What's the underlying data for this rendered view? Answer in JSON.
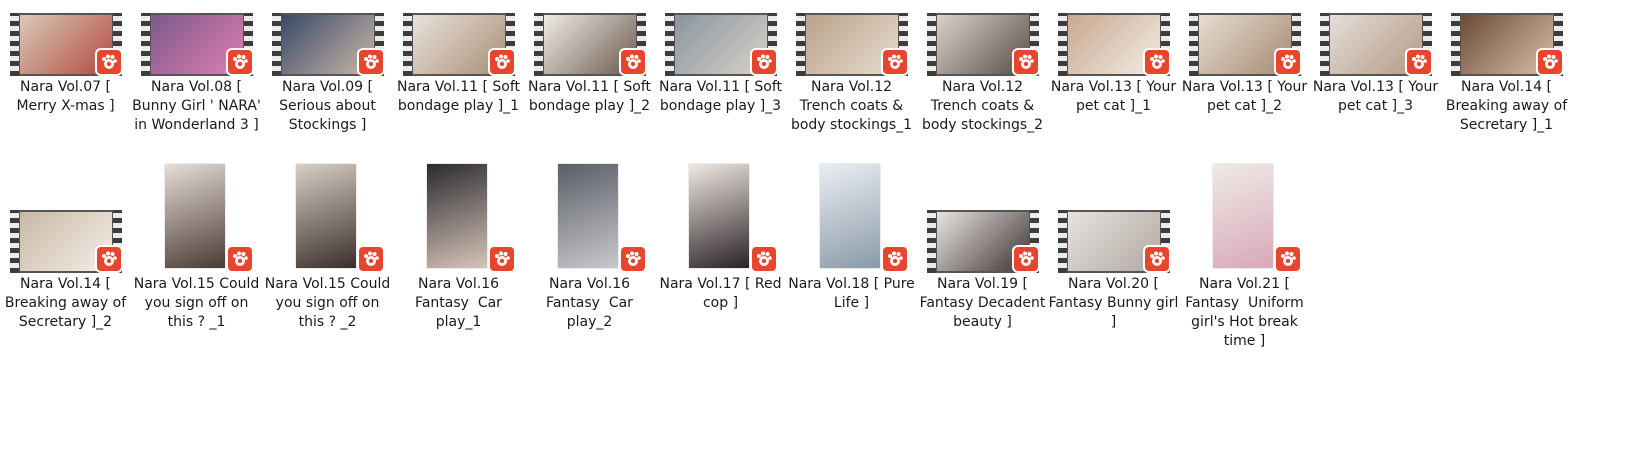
{
  "files": [
    {
      "name": "Nara Vol.07 [ Merry X-mas ]",
      "kind": "video",
      "icon": "video-file-icon",
      "colors": [
        "#d9c9b8",
        "#b24a3f"
      ]
    },
    {
      "name": "Nara Vol.08 [ Bunny Girl ' NARA' in Wonderland 3 ]",
      "kind": "video",
      "icon": "video-file-icon",
      "colors": [
        "#7a5a8a",
        "#e07fb0"
      ]
    },
    {
      "name": "Nara Vol.09 [ Serious about Stockings ]",
      "kind": "video",
      "icon": "video-file-icon",
      "colors": [
        "#3a4a6a",
        "#c9b7a8"
      ]
    },
    {
      "name": "Nara Vol.11 [ Soft bondage play ]_1",
      "kind": "video",
      "icon": "video-file-icon",
      "colors": [
        "#e8e2da",
        "#a88e78"
      ]
    },
    {
      "name": "Nara Vol.11 [ Soft bondage play ]_2",
      "kind": "video",
      "icon": "video-file-icon",
      "colors": [
        "#f0ece6",
        "#6a5a4e"
      ]
    },
    {
      "name": "Nara Vol.11 [ Soft bondage play ]_3",
      "kind": "video",
      "icon": "video-file-icon",
      "colors": [
        "#8a949e",
        "#d8d2ca"
      ]
    },
    {
      "name": "Nara Vol.12 Trench coats & body stockings_1",
      "kind": "video",
      "icon": "video-file-icon",
      "colors": [
        "#b8a28a",
        "#e8dccf"
      ]
    },
    {
      "name": "Nara Vol.12 Trench coats & body stockings_2",
      "kind": "video",
      "icon": "video-file-icon",
      "colors": [
        "#d8d2cc",
        "#5a4e46"
      ]
    },
    {
      "name": "Nara Vol.13 [ Your pet cat ]_1",
      "kind": "video",
      "icon": "video-file-icon",
      "colors": [
        "#c8a890",
        "#f2ece4"
      ]
    },
    {
      "name": "Nara Vol.13 [ Your pet cat ]_2",
      "kind": "video",
      "icon": "video-file-icon",
      "colors": [
        "#e6ddd2",
        "#a58a72"
      ]
    },
    {
      "name": "Nara Vol.13 [ Your pet cat ]_3",
      "kind": "video",
      "icon": "video-file-icon",
      "colors": [
        "#e4ded8",
        "#b39a86"
      ]
    },
    {
      "name": "Nara Vol.14 [ Breaking away of Secretary ]_1",
      "kind": "video",
      "icon": "video-file-icon",
      "colors": [
        "#6a4a36",
        "#d6c0a8"
      ]
    },
    {
      "name": "Nara Vol.14 [ Breaking away of Secretary ]_2",
      "kind": "video",
      "icon": "video-file-icon",
      "colors": [
        "#c8b8a4",
        "#f4efe8"
      ]
    },
    {
      "name": "Nara Vol.15 Could you sign off on this ? _1",
      "kind": "image",
      "icon": "image-file-icon",
      "colors": [
        "#e6ded6",
        "#4a3a34"
      ]
    },
    {
      "name": "Nara Vol.15 Could you sign off on this ? _2",
      "kind": "image",
      "icon": "image-file-icon",
      "colors": [
        "#d8cfc6",
        "#3a2e2a"
      ]
    },
    {
      "name": "Nara Vol.16 Fantasy  Car play_1",
      "kind": "image",
      "icon": "image-file-icon",
      "colors": [
        "#2a2a30",
        "#d8c4b8"
      ]
    },
    {
      "name": "Nara Vol.16 Fantasy  Car play_2",
      "kind": "image",
      "icon": "image-file-icon",
      "colors": [
        "#5a5e66",
        "#c8c8cc"
      ]
    },
    {
      "name": "Nara Vol.17 [ Red cop ]",
      "kind": "image",
      "icon": "image-file-icon",
      "colors": [
        "#efe9e2",
        "#2a2226"
      ]
    },
    {
      "name": "Nara Vol.18 [ Pure Life ]",
      "kind": "image",
      "icon": "image-file-icon",
      "colors": [
        "#eaeef2",
        "#8a9aa8"
      ]
    },
    {
      "name": "Nara Vol.19 [ Fantasy Decadent beauty ]",
      "kind": "video",
      "icon": "video-file-icon",
      "colors": [
        "#e8e4e2",
        "#3e3434"
      ]
    },
    {
      "name": "Nara Vol.20 [ Fantasy Bunny girl ]",
      "kind": "video",
      "icon": "video-file-icon",
      "colors": [
        "#e6e2de",
        "#b0a8a2"
      ]
    },
    {
      "name": "Nara Vol.21 [ Fantasy  Uniform girl's Hot break time ]",
      "kind": "image",
      "icon": "image-file-icon",
      "colors": [
        "#efeae6",
        "#d8a8b8"
      ]
    }
  ],
  "app_badge": {
    "icon": "media-player-badge-icon",
    "color": "#e8452e"
  }
}
